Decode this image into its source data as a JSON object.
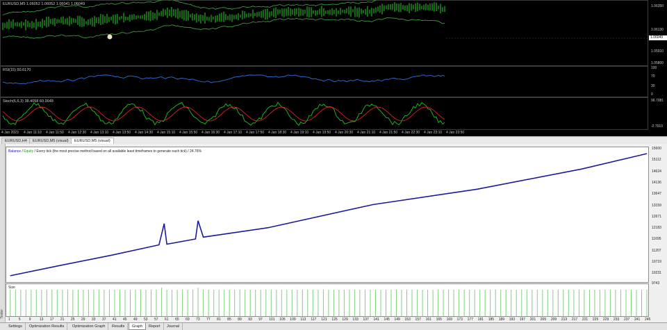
{
  "chart_window": {
    "main_label": "EURUSD,M5  1.06052 1.06052 1.06041 1.06049",
    "rsi_label": "RSI(15) 50.6170",
    "stoch_label": "Stoch(6,6,3) 38.4058 60.3648",
    "current_price_tag": "1.06049",
    "price_ticks": [
      "1.06350",
      "1.06130",
      "1.05910",
      "1.05800"
    ],
    "rsi_ticks": [
      "100",
      "70",
      "30",
      "0"
    ],
    "stoch_ticks": [
      "96.7081",
      "-2.7910"
    ],
    "time_ticks": [
      "4 Jan 2023",
      "4 Jan 11:10",
      "4 Jan 11:50",
      "4 Jan 12:30",
      "4 Jan 13:10",
      "4 Jan 13:50",
      "4 Jan 14:30",
      "4 Jan 15:10",
      "4 Jan 15:50",
      "4 Jan 16:30",
      "4 Jan 17:10",
      "4 Jan 17:50",
      "4 Jan 18:30",
      "4 Jan 19:10",
      "4 Jan 19:50",
      "4 Jan 20:30",
      "4 Jan 21:10",
      "4 Jan 21:50",
      "4 Jan 22:30",
      "4 Jan 23:10",
      "4 Jan 23:50"
    ],
    "colors": {
      "candles": "#29d629",
      "bands": "#3fae3f",
      "rsi": "#2f6fe0",
      "stoch_main": "#21c321",
      "stoch_signal": "#e02020"
    }
  },
  "chart_tabs": [
    "EURUSD,H4",
    "EURUSD,M5 (visual)",
    "EURUSD,M5 (visual)"
  ],
  "tester": {
    "side_label": "Tester",
    "graph_header_balance": "Balance",
    "graph_header_sep": " / ",
    "graph_header_equity": "Equity",
    "graph_header_rest": " / Every tick (the most precise method based on all available least timeframes to generate each tick) / 24.76%",
    "size_label": "Size",
    "balance_color": "#1a1a9a",
    "equity_color": "#1a9a1a",
    "size_bar_color": "#7fcf7f",
    "tabs": [
      "Settings",
      "Optimization Results",
      "Optimization Graph",
      "Results",
      "Graph",
      "Report",
      "Journal"
    ],
    "active_tab": "Graph"
  },
  "chart_data": {
    "type": "line",
    "title": "",
    "xlabel": "",
    "ylabel": "",
    "ylim": [
      9743,
      15600
    ],
    "y_ticks": [
      15600,
      15112,
      14624,
      14136,
      13647,
      13159,
      12671,
      12183,
      11695,
      11207,
      10719,
      10231,
      9743
    ],
    "x_ticks": [
      1,
      5,
      9,
      13,
      17,
      21,
      25,
      29,
      33,
      37,
      41,
      45,
      49,
      53,
      57,
      61,
      65,
      69,
      73,
      77,
      81,
      85,
      89,
      93,
      97,
      101,
      105,
      109,
      113,
      117,
      121,
      125,
      129,
      133,
      137,
      141,
      145,
      149,
      153,
      157,
      161,
      165,
      169,
      173,
      177,
      181,
      185,
      189,
      193,
      197,
      201,
      205,
      209,
      213,
      217,
      221,
      225,
      229,
      233,
      237,
      241,
      245
    ],
    "series": [
      {
        "name": "Balance",
        "x": [
          1,
          20,
          40,
          58,
          59,
          60,
          61,
          70,
          72,
          73,
          75,
          100,
          140,
          180,
          220,
          245
        ],
        "values": [
          9950,
          10380,
          10820,
          11250,
          11700,
          12150,
          11280,
          11460,
          11500,
          12270,
          11580,
          11980,
          12950,
          13600,
          14450,
          15100
        ]
      }
    ]
  }
}
